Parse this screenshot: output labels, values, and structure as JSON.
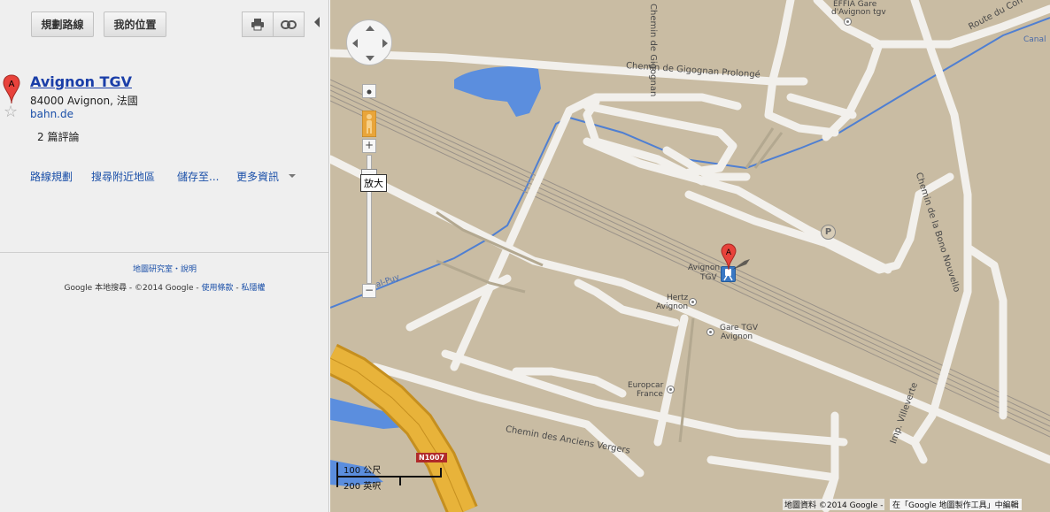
{
  "toolbar": {
    "directions_label": "規劃路線",
    "my_location_label": "我的位置",
    "print_icon": "printer-icon",
    "link_icon": "link-icon"
  },
  "place": {
    "title": "Avignon TGV",
    "address": "84000 Avignon, 法國",
    "website": "bahn.de",
    "reviews": "2 篇評論",
    "marker_letter": "A"
  },
  "actions": {
    "directions": "路線規劃",
    "search_nearby": "搜尋附近地區",
    "save_to": "儲存至...",
    "more_info": "更多資訊"
  },
  "footer": {
    "labs": "地圖研究室",
    "sep": "・",
    "help": "說明",
    "copyright_prefix": "Google 本地搜尋 - ©2014 Google - ",
    "terms": "使用條款",
    "privacy": "私隱權"
  },
  "map": {
    "zoom_tooltip": "放大",
    "scale_metric": "100 公尺",
    "scale_imperial": "200 英呎",
    "attribution": "地圖資料 ©2014 Google - ",
    "mymaps": "在「Google 地圖製作工具」中編輯",
    "route_badge": "N1007",
    "colors": {
      "land": "#c9bca3",
      "road": "#f2f0ec",
      "water": "#5b8ede",
      "highway": "#e8b33a",
      "rail": "#9a9289"
    },
    "labels": {
      "gigognan_prolonge": "Chemin de Gigognan Prolongé",
      "gigognan": "Chemin de Gigognan",
      "bono_nouvello": "Chemin de la Bono Nouvello",
      "anciens_vergers": "Chemin des Anciens Vergers",
      "villeverte": "Imp. Villeverte",
      "route_du_con": "Route du Con",
      "canal": "Canal",
      "puy": "al-Puy",
      "effia_line1": "EFFIA Gare",
      "effia_line2": "d'Avignon tgv",
      "avignon_tgv_line1": "Avignon",
      "avignon_tgv_line2": "TGV",
      "hertz_line1": "Hertz",
      "hertz_line2": "Avignon",
      "gare_line1": "Gare TGV",
      "gare_line2": "Avignon",
      "europcar_line1": "Europcar",
      "europcar_line2": "France",
      "parking": "P"
    }
  }
}
